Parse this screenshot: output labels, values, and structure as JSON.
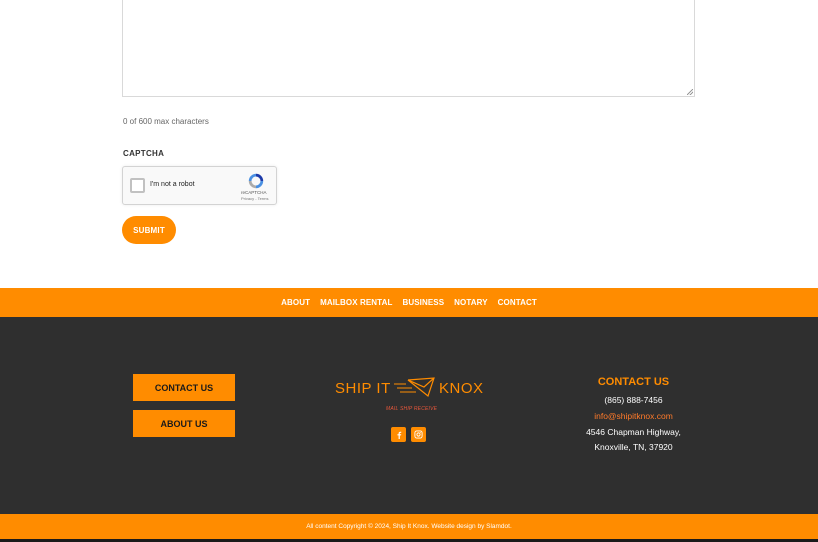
{
  "form": {
    "char_count": "0 of 600 max characters",
    "captcha_label": "CAPTCHA",
    "recaptcha_text": "I'm not a robot",
    "recaptcha_brand": "reCAPTCHA",
    "recaptcha_terms": "Privacy - Terms",
    "submit_label": "SUBMIT"
  },
  "nav": {
    "items": [
      "ABOUT",
      "MAILBOX RENTAL",
      "BUSINESS",
      "NOTARY",
      "CONTACT"
    ]
  },
  "footer": {
    "contact_button": "CONTACT US",
    "about_button": "ABOUT US",
    "logo_left": "SHIP IT",
    "logo_right": "KNOX",
    "tagline": "MAIL SHIP RECEIVE",
    "contact_heading": "CONTACT US",
    "phone": "(865) 888-7456",
    "email": "info@shipitknox.com",
    "address_line1": "4546 Chapman Highway,",
    "address_line2": "Knoxville, TN, 37920"
  },
  "copyright": "All content Copyright © 2024, Ship It Knox. Website design by Slamdot.",
  "colors": {
    "accent": "#ff8c00",
    "footer_bg": "#2f2f2f",
    "email_link": "#ff7a2a"
  },
  "icons": [
    "facebook-icon",
    "instagram-icon",
    "recaptcha-logo-icon",
    "paper-plane-envelope-icon"
  ]
}
